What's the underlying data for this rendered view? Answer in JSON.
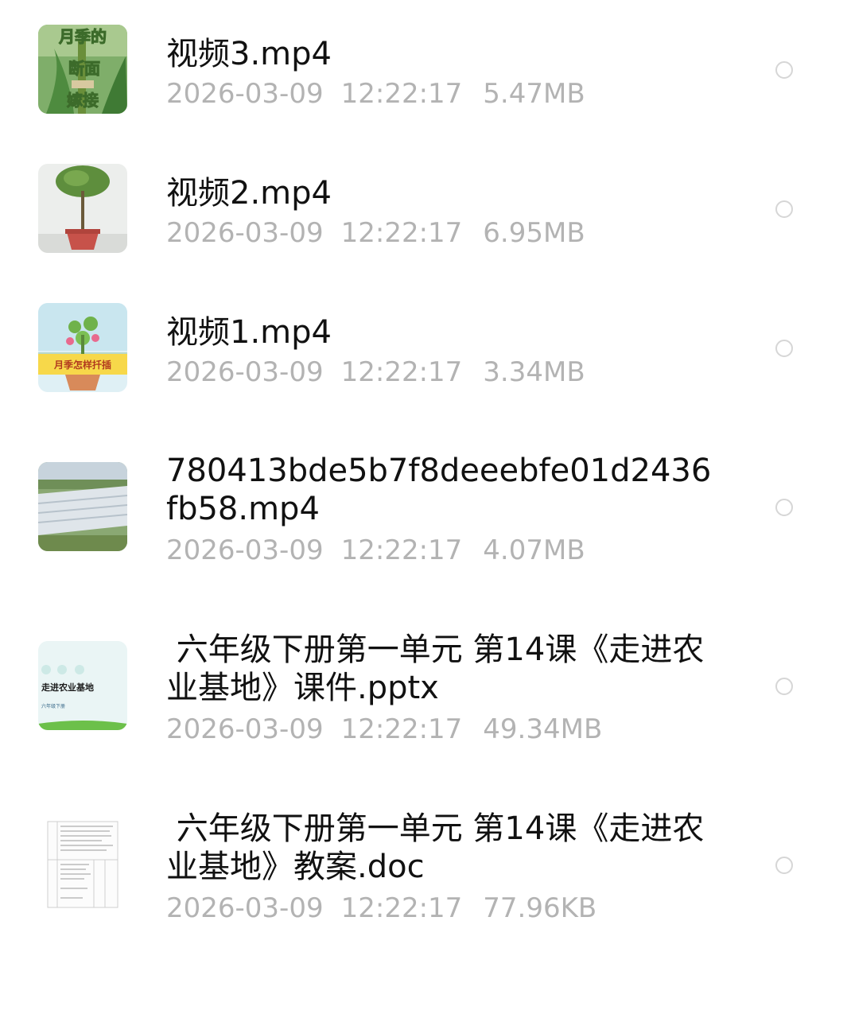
{
  "files": [
    {
      "name": "视频3.mp4",
      "date": "2026-03-09",
      "time": "12:22:17",
      "size": "5.47MB",
      "thumb_text": [
        "月季的",
        "断面",
        "嫁接"
      ],
      "thumb_icon": "plant-grafting-thumbnail"
    },
    {
      "name": "视频2.mp4",
      "date": "2026-03-09",
      "time": "12:22:17",
      "size": "6.95MB",
      "thumb_icon": "potted-tree-thumbnail"
    },
    {
      "name": "视频1.mp4",
      "date": "2026-03-09",
      "time": "12:22:17",
      "size": "3.34MB",
      "thumb_text": [
        "月季怎样扦插"
      ],
      "thumb_icon": "cartoon-plant-thumbnail"
    },
    {
      "name": "780413bde5b7f8deeebfe01d2436fb58.mp4",
      "date": "2026-03-09",
      "time": "12:22:17",
      "size": "4.07MB",
      "thumb_icon": "greenhouse-aerial-thumbnail"
    },
    {
      "name": " 六年级下册第一单元 第14课《走进农业基地》课件.pptx",
      "date": "2026-03-09",
      "time": "12:22:17",
      "size": "49.34MB",
      "thumb_text": [
        "走进农业基地",
        "六年级下册"
      ],
      "thumb_icon": "slide-thumbnail"
    },
    {
      "name": " 六年级下册第一单元 第14课《走进农业基地》教案.doc",
      "date": "2026-03-09",
      "time": "12:22:17",
      "size": "77.96KB",
      "thumb_icon": "document-thumbnail"
    }
  ],
  "colors": {
    "name_text": "#111111",
    "meta_text": "#b3b3b3",
    "radio_border": "#d6d6d6",
    "background": "#ffffff"
  }
}
